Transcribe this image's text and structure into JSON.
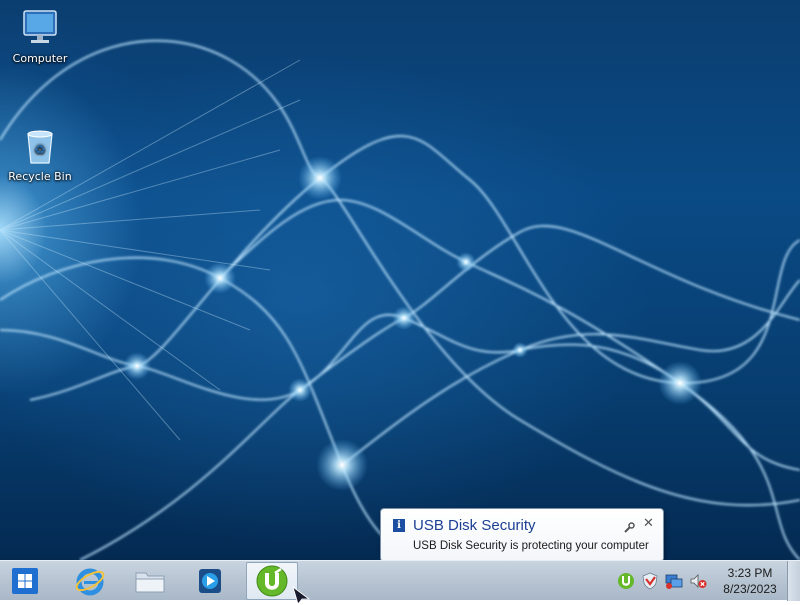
{
  "desktop": {
    "icons": [
      {
        "label": "Computer",
        "icon": "computer-icon"
      },
      {
        "label": "Recycle Bin",
        "icon": "recycle-bin-icon"
      }
    ]
  },
  "taskbar": {
    "start_icon": "windows-logo-icon",
    "pinned": [
      {
        "name": "Internet Explorer",
        "icon": "internet-explorer-icon"
      },
      {
        "name": "File Explorer",
        "icon": "folder-icon"
      },
      {
        "name": "Media Player",
        "icon": "media-player-icon"
      },
      {
        "name": "uTorrent",
        "icon": "utorrent-icon",
        "active": true
      }
    ],
    "tray": {
      "icons": [
        "utorrent-tray-icon",
        "usb-disk-security-icon",
        "network-icon",
        "volume-muted-icon"
      ],
      "clock": {
        "time": "3:23 PM",
        "date": "8/23/2023"
      }
    }
  },
  "notification": {
    "title": "USB Disk Security",
    "message": "USB Disk Security is protecting your computer",
    "info_icon": "i",
    "close_label": "X"
  },
  "colors": {
    "taskbar": "#b7c4d2",
    "balloon_title": "#1c3f94",
    "wallpaper_base": "#0a4a85",
    "wallpaper_glow": "#aee2ff"
  }
}
